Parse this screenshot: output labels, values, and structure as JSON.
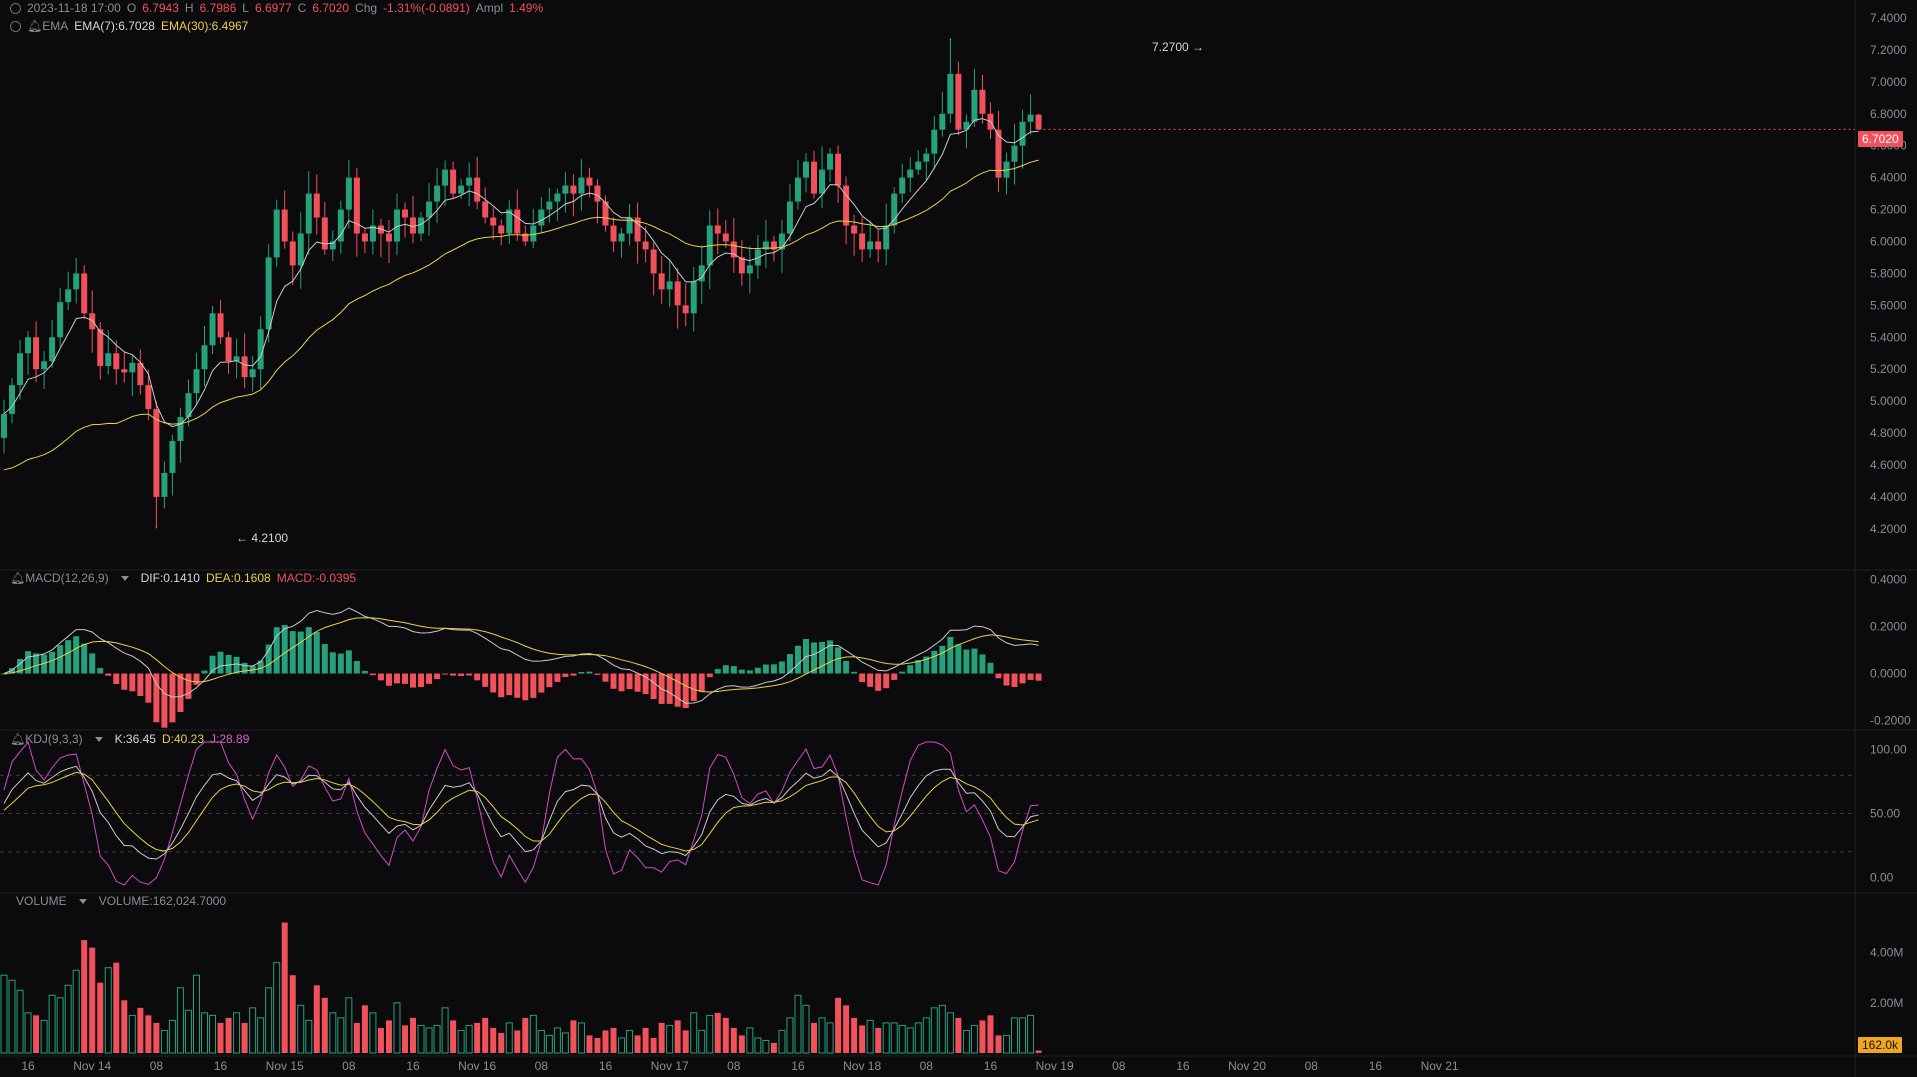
{
  "header": {
    "datetime": "2023-11-18 17:00",
    "open_label": "O",
    "open": "6.7943",
    "high_label": "H",
    "high": "6.7986",
    "low_label": "L",
    "low": "6.6977",
    "close_label": "C",
    "close": "6.7020",
    "chg_label": "Chg",
    "chg": "-1.31%(-0.0891)",
    "ampl_label": "Ampl",
    "ampl": "1.49%"
  },
  "ema_legend": {
    "name": "EMA",
    "ema7": "EMA(7):6.7028",
    "ema30": "EMA(30):6.4967"
  },
  "macd_legend": {
    "name": "MACD(12,26,9)",
    "dif": "DIF:0.1410",
    "dea": "DEA:0.1608",
    "macd": "MACD:-0.0395"
  },
  "kdj_legend": {
    "name": "KDJ(9,3,3)",
    "k": "K:36.45",
    "d": "D:40.23",
    "j": "J:28.89"
  },
  "volume_legend": {
    "name": "VOLUME",
    "value": "VOLUME:162,024.7000"
  },
  "price_tags": {
    "last": "6.7020",
    "last_volume": "162.0k",
    "high_marker": "7.2700 →",
    "low_marker": "← 4.2100"
  },
  "colors": {
    "up": "#26a17b",
    "down": "#f0515a",
    "ema7": "#c8c9cc",
    "ema30": "#e9d04b",
    "kdj_j": "#d24bc4",
    "volume_tag": "#f0a71d"
  },
  "chart_data": [
    {
      "type": "candlestick",
      "name": "price",
      "x": [
        "2023-11-13 13:00",
        "2023-11-13 14:00",
        "2023-11-13 15:00",
        "2023-11-13 16:00",
        "2023-11-13 17:00",
        "2023-11-13 18:00",
        "2023-11-13 19:00",
        "2023-11-13 20:00",
        "2023-11-13 21:00",
        "2023-11-13 22:00",
        "2023-11-13 23:00",
        "2023-11-14 00:00",
        "2023-11-14 01:00",
        "2023-11-14 02:00",
        "2023-11-14 03:00",
        "2023-11-14 04:00",
        "2023-11-14 05:00",
        "2023-11-14 06:00",
        "2023-11-14 07:00",
        "2023-11-14 08:00",
        "2023-11-14 09:00",
        "2023-11-14 10:00",
        "2023-11-14 11:00",
        "2023-11-14 12:00",
        "2023-11-14 13:00",
        "2023-11-14 14:00",
        "2023-11-14 15:00",
        "2023-11-14 16:00",
        "2023-11-14 17:00",
        "2023-11-14 18:00",
        "2023-11-14 19:00",
        "2023-11-14 20:00",
        "2023-11-14 21:00",
        "2023-11-14 22:00",
        "2023-11-14 23:00",
        "2023-11-15 00:00",
        "2023-11-15 01:00",
        "2023-11-15 02:00",
        "2023-11-15 03:00",
        "2023-11-15 04:00",
        "2023-11-15 05:00",
        "2023-11-15 06:00",
        "2023-11-15 07:00",
        "2023-11-15 08:00",
        "2023-11-15 09:00",
        "2023-11-15 10:00",
        "2023-11-15 11:00",
        "2023-11-15 12:00",
        "2023-11-15 13:00",
        "2023-11-15 14:00",
        "2023-11-15 15:00",
        "2023-11-15 16:00",
        "2023-11-15 17:00",
        "2023-11-15 18:00",
        "2023-11-15 19:00",
        "2023-11-15 20:00",
        "2023-11-15 21:00",
        "2023-11-15 22:00",
        "2023-11-15 23:00",
        "2023-11-16 00:00",
        "2023-11-16 01:00",
        "2023-11-16 02:00",
        "2023-11-16 03:00",
        "2023-11-16 04:00",
        "2023-11-16 05:00",
        "2023-11-16 06:00",
        "2023-11-16 07:00",
        "2023-11-16 08:00",
        "2023-11-16 09:00",
        "2023-11-16 10:00",
        "2023-11-16 11:00",
        "2023-11-16 12:00",
        "2023-11-16 13:00",
        "2023-11-16 14:00",
        "2023-11-16 15:00",
        "2023-11-16 16:00",
        "2023-11-16 17:00",
        "2023-11-16 18:00",
        "2023-11-16 19:00",
        "2023-11-16 20:00",
        "2023-11-16 21:00",
        "2023-11-16 22:00",
        "2023-11-16 23:00",
        "2023-11-17 00:00",
        "2023-11-17 01:00",
        "2023-11-17 02:00",
        "2023-11-17 03:00",
        "2023-11-17 04:00",
        "2023-11-17 05:00",
        "2023-11-17 06:00",
        "2023-11-17 07:00",
        "2023-11-17 08:00",
        "2023-11-17 09:00",
        "2023-11-17 10:00",
        "2023-11-17 11:00",
        "2023-11-17 12:00",
        "2023-11-17 13:00",
        "2023-11-17 14:00",
        "2023-11-17 15:00",
        "2023-11-17 16:00",
        "2023-11-17 17:00",
        "2023-11-17 18:00",
        "2023-11-17 19:00",
        "2023-11-17 20:00",
        "2023-11-17 21:00",
        "2023-11-17 22:00",
        "2023-11-17 23:00",
        "2023-11-18 00:00",
        "2023-11-18 01:00",
        "2023-11-18 02:00",
        "2023-11-18 03:00",
        "2023-11-18 04:00",
        "2023-11-18 05:00",
        "2023-11-18 06:00",
        "2023-11-18 07:00",
        "2023-11-18 08:00",
        "2023-11-18 09:00",
        "2023-11-18 10:00",
        "2023-11-18 11:00",
        "2023-11-18 12:00",
        "2023-11-18 13:00",
        "2023-11-18 14:00",
        "2023-11-18 15:00",
        "2023-11-18 16:00",
        "2023-11-18 17:00"
      ],
      "close": [
        4.92,
        5.1,
        5.3,
        5.4,
        5.2,
        5.25,
        5.4,
        5.62,
        5.7,
        5.8,
        5.55,
        5.45,
        5.22,
        5.3,
        5.2,
        5.18,
        5.24,
        5.1,
        4.95,
        4.4,
        4.55,
        4.75,
        4.9,
        5.05,
        5.2,
        5.35,
        5.55,
        5.4,
        5.25,
        5.28,
        5.15,
        5.2,
        5.45,
        5.9,
        6.2,
        6.0,
        5.85,
        6.05,
        6.3,
        6.15,
        5.95,
        6.0,
        6.2,
        6.4,
        6.05,
        6.0,
        6.1,
        6.05,
        6.0,
        6.2,
        6.15,
        6.05,
        6.15,
        6.25,
        6.35,
        6.45,
        6.3,
        6.35,
        6.4,
        6.25,
        6.15,
        6.1,
        6.05,
        6.2,
        6.05,
        6.0,
        6.1,
        6.2,
        6.25,
        6.3,
        6.35,
        6.3,
        6.4,
        6.35,
        6.25,
        6.1,
        6.0,
        6.05,
        6.15,
        6.0,
        5.95,
        5.8,
        5.7,
        5.75,
        5.6,
        5.55,
        5.75,
        5.85,
        6.1,
        6.05,
        6.0,
        5.9,
        5.8,
        5.85,
        5.95,
        6.0,
        5.95,
        6.05,
        6.25,
        6.4,
        6.5,
        6.3,
        6.45,
        6.55,
        6.35,
        6.1,
        6.05,
        5.95,
        6.0,
        5.95,
        6.1,
        6.3,
        6.4,
        6.45,
        6.5,
        6.55,
        6.7,
        6.8,
        7.05,
        6.7,
        6.75,
        6.95,
        6.8,
        6.7,
        6.4,
        6.5,
        6.6,
        6.75,
        6.7943,
        6.702
      ],
      "high_point": {
        "x": "2023-11-18 11:00",
        "value": 7.27
      },
      "low_point": {
        "x": "2023-11-14 08:00",
        "value": 4.21
      },
      "y_ticks": [
        4.2,
        4.4,
        4.6,
        4.8,
        5.0,
        5.2,
        5.4,
        5.6,
        5.8,
        6.0,
        6.2,
        6.4,
        6.6,
        6.8,
        7.0,
        7.2,
        7.4
      ],
      "ylim": [
        4.13,
        7.45
      ]
    },
    {
      "type": "line",
      "name": "ema",
      "series": [
        {
          "name": "EMA(7)",
          "last": 6.7028
        },
        {
          "name": "EMA(30)",
          "last": 6.4967
        }
      ]
    },
    {
      "type": "bar",
      "name": "macd",
      "y_ticks": [
        -0.2,
        0.0,
        0.2,
        0.4
      ],
      "ylim": [
        -0.24,
        0.44
      ],
      "dif_last": 0.141,
      "dea_last": 0.1608,
      "macd_last": -0.0395
    },
    {
      "type": "line",
      "name": "kdj",
      "y_ticks": [
        0.0,
        50.0,
        100.0
      ],
      "ylim": [
        -6,
        106
      ],
      "k_last": 36.45,
      "d_last": 40.23,
      "j_last": 28.89
    },
    {
      "type": "bar",
      "name": "volume",
      "y_ticks_labels": [
        "2.00M",
        "4.00M"
      ],
      "y_ticks": [
        2000000,
        4000000
      ],
      "values": [
        3100000.0,
        2900000.0,
        2500000.0,
        1600000.0,
        1500000.0,
        1300000.0,
        2300000.0,
        2200000.0,
        2700000.0,
        3300000.0,
        4500000.0,
        4200000.0,
        2800000.0,
        3400000.0,
        3600000.0,
        2100000.0,
        1500000.0,
        1800000.0,
        1500000.0,
        1200000.0,
        900000.0,
        1300000.0,
        2600000.0,
        1700000.0,
        3100000.0,
        1600000.0,
        1500000.0,
        1200000.0,
        1400000.0,
        1600000.0,
        1200000.0,
        1800000.0,
        1400000.0,
        2600000.0,
        3600000.0,
        5200000.0,
        3100000.0,
        1900000.0,
        1300000.0,
        2700000.0,
        2200000.0,
        1600000.0,
        1400000.0,
        2200000.0,
        1200000.0,
        1900000.0,
        1600000.0,
        1000000.0,
        1300000.0,
        2000000.0,
        1100000.0,
        1400000.0,
        1100000.0,
        1000000.0,
        1100000.0,
        1800000.0,
        1300000.0,
        900000.0,
        1100000.0,
        1200000.0,
        1400000.0,
        1000000.0,
        800000.0,
        1200000.0,
        900000.0,
        1400000.0,
        1500000.0,
        900000.0,
        700000.0,
        1000000.0,
        800000.0,
        1300000.0,
        1200000.0,
        700000.0,
        600000.0,
        900000.0,
        1000000.0,
        600000.0,
        900000.0,
        700000.0,
        1000000.0,
        600000.0,
        1200000.0,
        1100000.0,
        1300000.0,
        900000.0,
        1600000.0,
        900000.0,
        1500000.0,
        1600000.0,
        1400000.0,
        1000000.0,
        700000.0,
        1000000.0,
        600000.0,
        500000.0,
        400000.0,
        900000.0,
        1400000.0,
        2300000.0,
        1900000.0,
        1200000.0,
        1400000.0,
        1200000.0,
        2200000.0,
        1900000.0,
        1400000.0,
        1100000.0,
        1300000.0,
        1000000.0,
        1200000.0,
        1200000.0,
        1100000.0,
        1000000.0,
        1200000.0,
        1400000.0,
        1800000.0,
        1900000.0,
        1600000.0,
        1400000.0,
        900000.0,
        1100000.0,
        1300000.0,
        1500000.0,
        700000.0,
        700000.0,
        1400000.0,
        1400000.0,
        1500000.0,
        100000.0
      ]
    },
    {
      "type": "axis",
      "name": "time-axis",
      "labels": [
        {
          "text": "16",
          "x": "2023-11-13 16:00"
        },
        {
          "text": "Nov 14",
          "x": "2023-11-14 00:00"
        },
        {
          "text": "08",
          "x": "2023-11-14 08:00"
        },
        {
          "text": "16",
          "x": "2023-11-14 16:00"
        },
        {
          "text": "Nov 15",
          "x": "2023-11-15 00:00"
        },
        {
          "text": "08",
          "x": "2023-11-15 08:00"
        },
        {
          "text": "16",
          "x": "2023-11-15 16:00"
        },
        {
          "text": "Nov 16",
          "x": "2023-11-16 00:00"
        },
        {
          "text": "08",
          "x": "2023-11-16 08:00"
        },
        {
          "text": "16",
          "x": "2023-11-16 16:00"
        },
        {
          "text": "Nov 17",
          "x": "2023-11-17 00:00"
        },
        {
          "text": "08",
          "x": "2023-11-17 08:00"
        },
        {
          "text": "16",
          "x": "2023-11-17 16:00"
        },
        {
          "text": "Nov 18",
          "x": "2023-11-18 00:00"
        },
        {
          "text": "08",
          "x": "2023-11-18 08:00"
        },
        {
          "text": "16",
          "x": "2023-11-18 16:00"
        },
        {
          "text": "Nov 19",
          "x": "2023-11-19 00:00"
        },
        {
          "text": "08",
          "x": "2023-11-19 08:00"
        },
        {
          "text": "16",
          "x": "2023-11-19 16:00"
        },
        {
          "text": "Nov 20",
          "x": "2023-11-20 00:00"
        },
        {
          "text": "08",
          "x": "2023-11-20 08:00"
        },
        {
          "text": "16",
          "x": "2023-11-20 16:00"
        },
        {
          "text": "Nov 21",
          "x": "2023-11-21 00:00"
        }
      ]
    }
  ]
}
